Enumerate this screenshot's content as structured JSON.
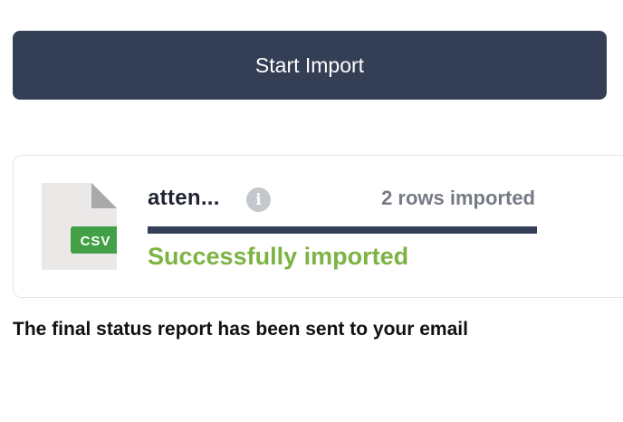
{
  "import_button": {
    "label": "Start Import"
  },
  "file_card": {
    "file_name": "atten...",
    "file_type_badge": "CSV",
    "info_icon": "info-icon",
    "rows_imported_text": "2 rows imported",
    "progress": 1.0,
    "status_text": "Successfully imported",
    "colors": {
      "progress_fill": "#343f56",
      "status_success": "#7cb342",
      "badge_bg": "#43a047"
    }
  },
  "footer": {
    "report_message": "The final status report has been sent to your email"
  },
  "colors": {
    "button_bg": "#343f56",
    "button_text": "#ffffff"
  }
}
